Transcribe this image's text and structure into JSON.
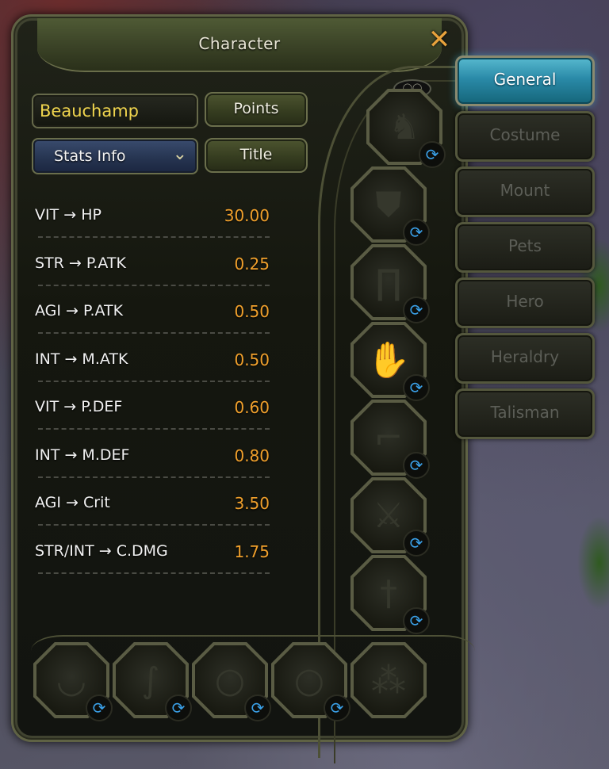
{
  "window": {
    "title": "Character",
    "close_label": "✕"
  },
  "character": {
    "name": "Beauchamp",
    "points_label": "Points",
    "title_label": "Title",
    "stats_dropdown": {
      "selected": "Stats Info"
    }
  },
  "stats": [
    {
      "label": "VIT → HP",
      "value": "30.00"
    },
    {
      "label": "STR → P.ATK",
      "value": "0.25"
    },
    {
      "label": "AGI → P.ATK",
      "value": "0.50"
    },
    {
      "label": "INT → M.ATK",
      "value": "0.50"
    },
    {
      "label": "VIT → P.DEF",
      "value": "0.60"
    },
    {
      "label": "INT → M.DEF",
      "value": "0.80"
    },
    {
      "label": "AGI → Crit",
      "value": "3.50"
    },
    {
      "label": "STR/INT → C.DMG",
      "value": "1.75"
    }
  ],
  "tabs": [
    {
      "label": "General",
      "active": true
    },
    {
      "label": "Costume",
      "active": false
    },
    {
      "label": "Mount",
      "active": false
    },
    {
      "label": "Pets",
      "active": false
    },
    {
      "label": "Hero",
      "active": false
    },
    {
      "label": "Heraldry",
      "active": false
    },
    {
      "label": "Talisman",
      "active": false
    }
  ],
  "equipment_slots": [
    {
      "icon": "helmet-icon"
    },
    {
      "icon": "armor-icon"
    },
    {
      "icon": "pants-icon"
    },
    {
      "icon": "gloves-icon"
    },
    {
      "icon": "boots-icon"
    },
    {
      "icon": "sword-icon"
    },
    {
      "icon": "dagger-icon"
    },
    {
      "icon": "necklace-icon"
    },
    {
      "icon": "earring-icon"
    },
    {
      "icon": "ring-icon"
    },
    {
      "icon": "ring-icon"
    },
    {
      "icon": "talisman-icon"
    }
  ],
  "colors": {
    "stat_value": "#f0a02c",
    "name": "#f0d54e",
    "active_tab": "#2a8aa8",
    "swap_icon": "#3aa0e8"
  }
}
